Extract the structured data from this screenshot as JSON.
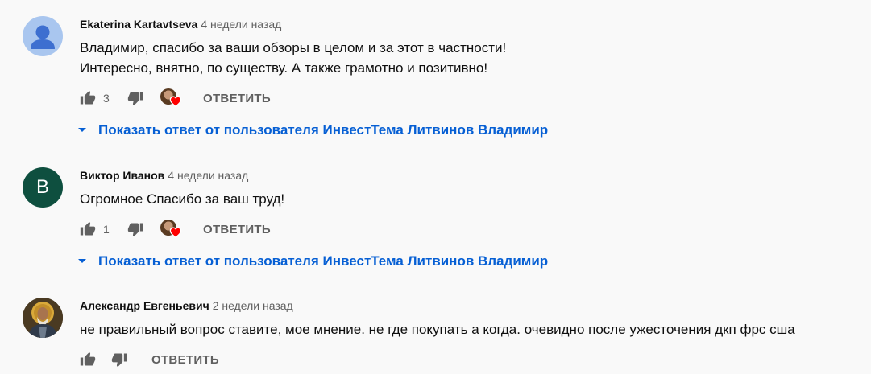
{
  "comments": [
    {
      "author": "Ekaterina Kartavtseva",
      "time": "4 недели назад",
      "avatar": {
        "type": "generic",
        "icon": "person-icon"
      },
      "lines": [
        "Владимир, спасибо за ваши обзоры в целом и за этот в частности!",
        "Интересно, внятно, по существу. А также грамотно и позитивно!"
      ],
      "likes": "3",
      "reply_label": "ОТВЕТИТЬ",
      "hearted": true,
      "show_replies": "Показать ответ от пользователя ИнвестТема Литвинов Владимир"
    },
    {
      "author": "Виктор Иванов",
      "time": "4 недели назад",
      "avatar": {
        "type": "letter",
        "letter": "В",
        "color": "#0e4f3f"
      },
      "lines": [
        "Огромное Спасибо за ваш труд!"
      ],
      "likes": "1",
      "reply_label": "ОТВЕТИТЬ",
      "hearted": true,
      "show_replies": "Показать ответ от пользователя ИнвестТема Литвинов Владимир"
    },
    {
      "author": "Александр Евгеньевич",
      "time": "2 недели назад",
      "avatar": {
        "type": "image",
        "icon": "religious-icon-avatar"
      },
      "lines": [
        "не правильный вопрос ставите, мое мнение. не где покупать а когда. очевидно после ужесточения дкп фрс сша"
      ],
      "likes": "",
      "reply_label": "ОТВЕТИТЬ",
      "hearted": false
    }
  ],
  "colors": {
    "background": "#f9f9f9",
    "link_blue": "#065fd4",
    "secondary_text": "#606060",
    "heart_red": "#ff0000"
  }
}
